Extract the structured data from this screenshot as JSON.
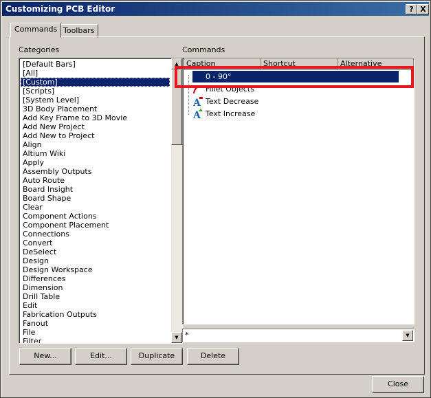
{
  "window": {
    "title": "Customizing PCB Editor",
    "help_label": "?",
    "close_label": "X"
  },
  "tabs": [
    {
      "label": "Commands"
    },
    {
      "label": "Toolbars"
    }
  ],
  "categories": {
    "label": "Categories",
    "selected": "[Custom]",
    "items": [
      "[Default Bars]",
      "[All]",
      "[Custom]",
      "[Scripts]",
      "[System Level]",
      "3D Body Placement",
      "Add Key Frame to 3D Movie",
      "Add New Project",
      "Add New to Project",
      "Align",
      "Altium Wiki",
      "Apply",
      "Assembly Outputs",
      "Auto Route",
      "Board Insight",
      "Board Shape",
      "Clear",
      "Component Actions",
      "Component Placement",
      "Connections",
      "Convert",
      "DeSelect",
      "Design",
      "Design Workspace",
      "Differences",
      "Dimension",
      "Drill Table",
      "Edit",
      "Fabrication Outputs",
      "Fanout",
      "File",
      "Filter"
    ]
  },
  "commands": {
    "label": "Commands",
    "columns": [
      "Caption",
      "Shortcut",
      "Alternative"
    ],
    "items": [
      {
        "caption": "0 - 90°",
        "icon": "rotate-icon",
        "selected": true
      },
      {
        "caption": "Fillet Objects",
        "icon": "fillet-icon",
        "selected": false
      },
      {
        "caption": "Text Decrease",
        "icon": "text-decrease-icon",
        "selected": false
      },
      {
        "caption": "Text Increase",
        "icon": "text-increase-icon",
        "selected": false
      }
    ],
    "filter_value": "*"
  },
  "buttons": {
    "new": "New...",
    "edit": "Edit...",
    "duplicate": "Duplicate",
    "delete": "Delete",
    "close": "Close"
  },
  "colors": {
    "selection": "#0a246a",
    "highlight_box": "#e8161f"
  }
}
